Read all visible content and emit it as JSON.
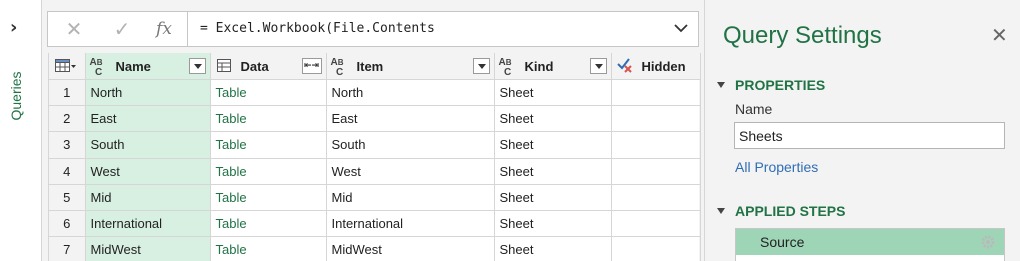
{
  "sidebar": {
    "label": "Queries",
    "expand_icon": "chevron-right-icon"
  },
  "formula_bar": {
    "cancel_icon": "close-icon",
    "commit_icon": "check-icon",
    "fx_label": "fx",
    "formula": "= Excel.Workbook(File.Contents",
    "expand_icon": "chevron-down-icon"
  },
  "grid": {
    "columns": [
      {
        "label": "Name",
        "type": "text"
      },
      {
        "label": "Data",
        "type": "table"
      },
      {
        "label": "Item",
        "type": "text"
      },
      {
        "label": "Kind",
        "type": "text"
      },
      {
        "label": "Hidden",
        "type": "boolean"
      }
    ],
    "rows": [
      {
        "num": "1",
        "name": "North",
        "data": "Table",
        "item": "North",
        "kind": "Sheet",
        "hidden": ""
      },
      {
        "num": "2",
        "name": "East",
        "data": "Table",
        "item": "East",
        "kind": "Sheet",
        "hidden": ""
      },
      {
        "num": "3",
        "name": "South",
        "data": "Table",
        "item": "South",
        "kind": "Sheet",
        "hidden": ""
      },
      {
        "num": "4",
        "name": "West",
        "data": "Table",
        "item": "West",
        "kind": "Sheet",
        "hidden": ""
      },
      {
        "num": "5",
        "name": "Mid",
        "data": "Table",
        "item": "Mid",
        "kind": "Sheet",
        "hidden": ""
      },
      {
        "num": "6",
        "name": "International",
        "data": "Table",
        "item": "International",
        "kind": "Sheet",
        "hidden": ""
      },
      {
        "num": "7",
        "name": "MidWest",
        "data": "Table",
        "item": "MidWest",
        "kind": "Sheet",
        "hidden": ""
      }
    ]
  },
  "settings": {
    "title": "Query Settings",
    "close_icon": "close-icon",
    "properties_heading": "PROPERTIES",
    "name_label": "Name",
    "name_value": "Sheets",
    "all_properties_link": "All Properties",
    "applied_steps_heading": "APPLIED STEPS",
    "steps": [
      {
        "label": "Source",
        "icon": "gear-icon"
      }
    ]
  },
  "colors": {
    "accent": "#217346",
    "selected_column": "#d8f0e2",
    "selected_step": "#9fd5b7",
    "link": "#2f6eb5"
  }
}
